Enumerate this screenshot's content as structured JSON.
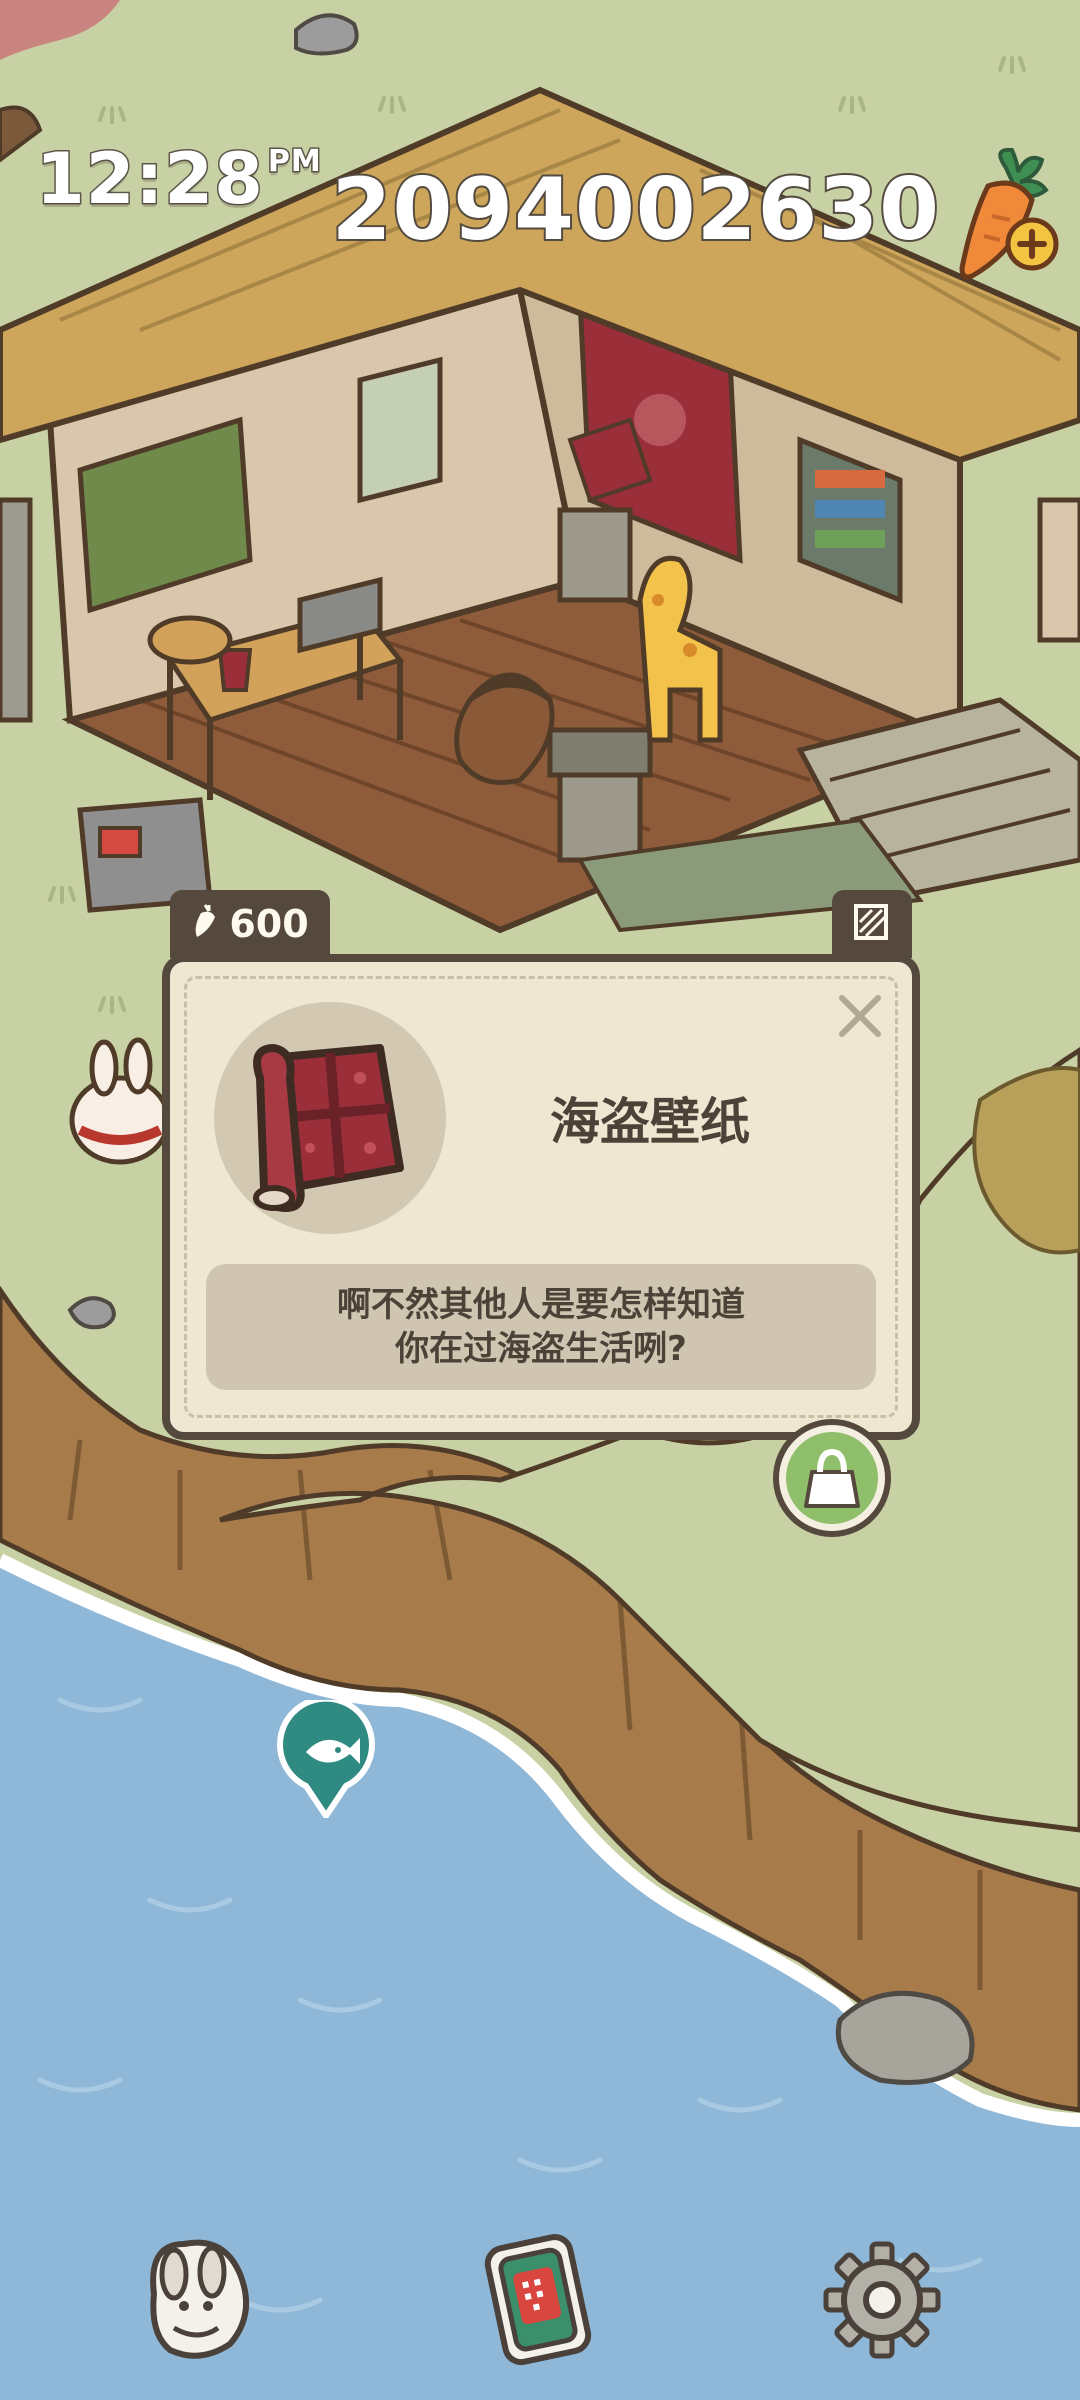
{
  "hud": {
    "time": "12:28",
    "time_suffix": "PM",
    "carrot_balance": "2094002630",
    "carrot_add_icon": "carrot-plus-icon"
  },
  "popup": {
    "price": "600",
    "price_icon": "carrot-icon",
    "category_icon": "wallpaper-icon",
    "item_icon": "pirate-wallpaper-roll",
    "item_name": "海盗壁纸",
    "description": "啊不然其他人是要怎样知道\n你在过海盗生活咧?",
    "close_icon": "close-icon"
  },
  "map": {
    "shop_icon": "shopping-bag-icon",
    "fishing_icon": "fish-marker-icon"
  },
  "bottom_bar": {
    "items": [
      {
        "icon": "bunny-collection-icon"
      },
      {
        "icon": "phone-icon"
      },
      {
        "icon": "gear-icon"
      }
    ]
  },
  "colors": {
    "grass": "#c7d0a3",
    "sea": "#8fb8d8",
    "cliff": "#a77b4a",
    "panel_border": "#55483c",
    "panel_bg": "#efe7d2",
    "shop_green": "#8fbf6b"
  }
}
